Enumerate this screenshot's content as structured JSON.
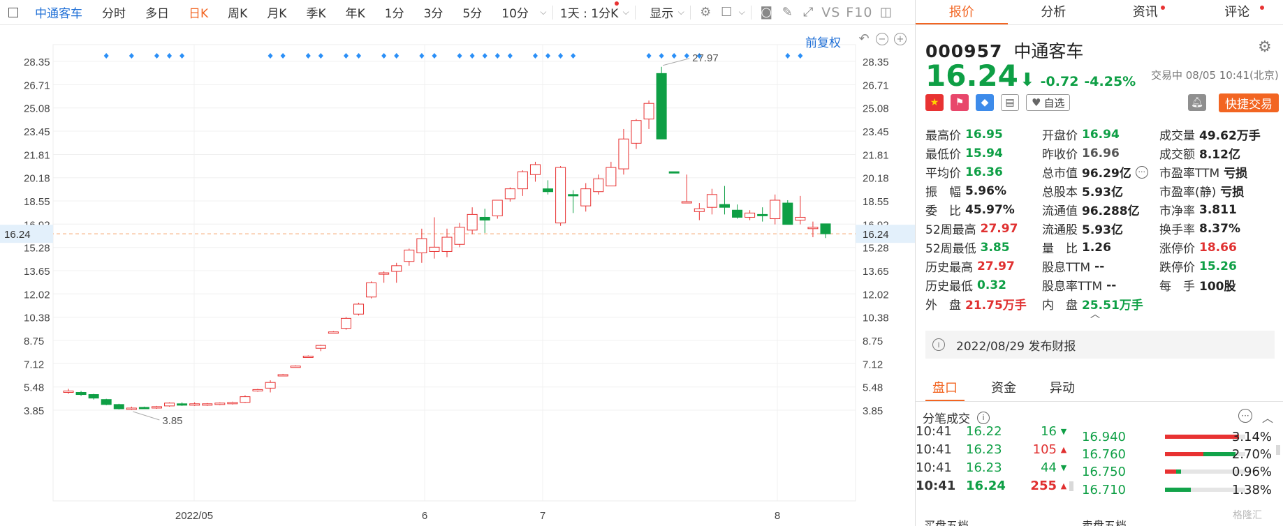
{
  "toolbar": {
    "stock_name": "中通客车",
    "periods": [
      "分时",
      "多日",
      "日K",
      "周K",
      "月K",
      "季K",
      "年K",
      "1分",
      "3分",
      "5分",
      "10分"
    ],
    "active_period": "日K",
    "range_select": "1天 : 1分K",
    "display_label": "显示",
    "vs_label": "VS",
    "f10_label": "F10"
  },
  "chart": {
    "fq_label": "前复权",
    "ctrl_labels": [
      "−",
      "+"
    ]
  },
  "chart_data": {
    "type": "candlestick",
    "y_ticks": [
      28.35,
      26.71,
      25.08,
      23.45,
      21.81,
      20.18,
      18.55,
      16.92,
      15.28,
      13.65,
      12.02,
      10.38,
      8.75,
      7.12,
      5.48,
      3.85
    ],
    "x_labels": [
      "2022/05",
      "6",
      "7",
      "8"
    ],
    "current_price": "16.24",
    "high_note": "27.97",
    "low_note": "3.85",
    "candles": [
      [
        5.2,
        5.35,
        5.1,
        5.0,
        "r"
      ],
      [
        5.1,
        5.2,
        4.95,
        4.85,
        "g"
      ],
      [
        4.95,
        5.0,
        4.7,
        4.6,
        "g"
      ],
      [
        4.6,
        4.65,
        4.25,
        4.2,
        "g"
      ],
      [
        4.25,
        4.3,
        3.95,
        3.9,
        "g"
      ],
      [
        3.95,
        4.1,
        4.0,
        3.85,
        "r"
      ],
      [
        4.0,
        4.1,
        4.05,
        3.95,
        "g"
      ],
      [
        4.0,
        4.15,
        4.1,
        3.95,
        "r"
      ],
      [
        4.15,
        4.4,
        4.35,
        4.1,
        "r"
      ],
      [
        4.3,
        4.4,
        4.2,
        4.15,
        "g"
      ],
      [
        4.2,
        4.4,
        4.3,
        4.15,
        "r"
      ],
      [
        4.2,
        4.35,
        4.3,
        4.15,
        "r"
      ],
      [
        4.25,
        4.4,
        4.35,
        4.2,
        "r"
      ],
      [
        4.3,
        4.45,
        4.4,
        4.25,
        "r"
      ],
      [
        4.4,
        4.9,
        4.8,
        4.35,
        "r"
      ],
      [
        5.2,
        5.35,
        5.3,
        5.15,
        "r"
      ],
      [
        5.4,
        5.95,
        5.8,
        5.1,
        "r"
      ],
      [
        6.3,
        6.4,
        6.35,
        6.25,
        "r"
      ],
      [
        6.9,
        7.0,
        6.95,
        6.85,
        "r"
      ],
      [
        7.6,
        7.7,
        7.65,
        7.55,
        "r"
      ],
      [
        8.2,
        8.45,
        8.4,
        8.0,
        "r"
      ],
      [
        9.3,
        9.4,
        9.35,
        9.25,
        "r"
      ],
      [
        9.6,
        10.4,
        10.3,
        9.5,
        "r"
      ],
      [
        10.6,
        11.4,
        11.3,
        10.5,
        "r"
      ],
      [
        11.8,
        12.9,
        12.8,
        11.7,
        "r"
      ],
      [
        13.4,
        13.6,
        13.5,
        12.8,
        "r"
      ],
      [
        13.6,
        14.2,
        14.0,
        12.8,
        "r"
      ],
      [
        14.3,
        15.2,
        15.1,
        14.0,
        "r"
      ],
      [
        14.9,
        16.6,
        15.9,
        14.2,
        "r"
      ],
      [
        15.0,
        17.4,
        15.3,
        14.5,
        "r"
      ],
      [
        15.0,
        16.6,
        16.0,
        14.6,
        "r"
      ],
      [
        15.5,
        17.0,
        16.7,
        15.3,
        "r"
      ],
      [
        16.5,
        18.1,
        17.6,
        16.2,
        "r"
      ],
      [
        17.4,
        18.0,
        17.2,
        16.3,
        "g"
      ],
      [
        17.5,
        18.6,
        18.6,
        17.3,
        "r"
      ],
      [
        18.7,
        19.5,
        19.4,
        18.5,
        "r"
      ],
      [
        19.4,
        20.7,
        20.6,
        18.9,
        "r"
      ],
      [
        20.4,
        21.3,
        21.1,
        19.9,
        "r"
      ],
      [
        19.4,
        20.0,
        19.2,
        19.0,
        "g"
      ],
      [
        17.0,
        21.0,
        20.9,
        16.8,
        "r"
      ],
      [
        19.0,
        19.3,
        18.9,
        17.7,
        "g"
      ],
      [
        18.2,
        19.8,
        19.4,
        17.8,
        "r"
      ],
      [
        19.2,
        20.4,
        20.1,
        19.0,
        "r"
      ],
      [
        19.6,
        21.3,
        20.9,
        19.6,
        "r"
      ],
      [
        20.8,
        23.6,
        22.9,
        20.4,
        "r"
      ],
      [
        22.6,
        24.3,
        24.2,
        22.2,
        "r"
      ],
      [
        24.3,
        25.6,
        25.4,
        23.6,
        "r"
      ],
      [
        27.5,
        27.97,
        22.9,
        22.9,
        "g"
      ],
      [
        20.6,
        20.6,
        20.6,
        20.5,
        "g"
      ],
      [
        18.5,
        20.4,
        18.5,
        18.4,
        "r"
      ],
      [
        17.8,
        18.4,
        18.0,
        17.2,
        "r"
      ],
      [
        18.1,
        19.4,
        19.0,
        17.6,
        "r"
      ],
      [
        18.3,
        19.6,
        18.1,
        17.6,
        "g"
      ],
      [
        17.9,
        18.3,
        17.4,
        17.3,
        "g"
      ],
      [
        17.4,
        17.9,
        17.7,
        17.2,
        "r"
      ],
      [
        17.6,
        18.1,
        17.55,
        17.1,
        "g"
      ],
      [
        17.3,
        19.0,
        18.6,
        16.9,
        "r"
      ],
      [
        18.4,
        18.6,
        16.9,
        16.9,
        "g"
      ],
      [
        17.2,
        18.9,
        17.4,
        16.9,
        "r"
      ],
      [
        16.6,
        17.1,
        16.7,
        16.0,
        "r"
      ],
      [
        16.94,
        16.95,
        16.24,
        15.94,
        "g"
      ]
    ],
    "blue_marker_indices": [
      3,
      5,
      7,
      8,
      9,
      16,
      17,
      19,
      20,
      22,
      23,
      25,
      26,
      28,
      29,
      31,
      32,
      33,
      34,
      35,
      37,
      38,
      39,
      40,
      46,
      47,
      48,
      49,
      50,
      57,
      58
    ]
  },
  "panel": {
    "tabs": [
      "报价",
      "分析",
      "资讯",
      "评论"
    ],
    "active_tab": "报价",
    "code": "000957",
    "name": "中通客车",
    "price": "16.24",
    "arrow": "⬇",
    "change": "-0.72",
    "change_pct": "-4.25%",
    "status": "交易中 08/05 10:41(北京)",
    "watch_label": "自选",
    "quick_trade": "快捷交易",
    "stats": [
      [
        {
          "l": "最高价",
          "v": "16.95",
          "c": "c-green"
        },
        {
          "l": "开盘价",
          "v": "16.94",
          "c": "c-green"
        },
        {
          "l": "成交量",
          "v": "49.62万手",
          "c": "c-dark"
        }
      ],
      [
        {
          "l": "最低价",
          "v": "15.94",
          "c": "c-green"
        },
        {
          "l": "昨收价",
          "v": "16.96",
          "c": "c-gray"
        },
        {
          "l": "成交额",
          "v": "8.12亿",
          "c": "c-dark"
        }
      ],
      [
        {
          "l": "平均价",
          "v": "16.36",
          "c": "c-green"
        },
        {
          "l": "总市值",
          "v": "96.29亿",
          "c": "c-dark"
        },
        {
          "l": "市盈率TTM",
          "v": "亏损",
          "c": "c-dark"
        }
      ],
      [
        {
          "l": "振　幅",
          "v": "5.96%",
          "c": "c-dark"
        },
        {
          "l": "总股本",
          "v": "5.93亿",
          "c": "c-dark"
        },
        {
          "l": "市盈率(静)",
          "v": "亏损",
          "c": "c-dark"
        }
      ],
      [
        {
          "l": "委　比",
          "v": "45.97%",
          "c": "c-dark"
        },
        {
          "l": "流通值",
          "v": "96.288亿",
          "c": "c-dark"
        },
        {
          "l": "市净率",
          "v": "3.811",
          "c": "c-dark"
        }
      ],
      [
        {
          "l": "52周最高",
          "v": "27.97",
          "c": "c-red"
        },
        {
          "l": "流通股",
          "v": "5.93亿",
          "c": "c-dark"
        },
        {
          "l": "换手率",
          "v": "8.37%",
          "c": "c-dark"
        }
      ],
      [
        {
          "l": "52周最低",
          "v": "3.85",
          "c": "c-green"
        },
        {
          "l": "量　比",
          "v": "1.26",
          "c": "c-dark"
        },
        {
          "l": "涨停价",
          "v": "18.66",
          "c": "c-red"
        }
      ],
      [
        {
          "l": "历史最高",
          "v": "27.97",
          "c": "c-red"
        },
        {
          "l": "股息TTM",
          "v": "--",
          "c": "c-dark"
        },
        {
          "l": "跌停价",
          "v": "15.26",
          "c": "c-green"
        }
      ],
      [
        {
          "l": "历史最低",
          "v": "0.32",
          "c": "c-green"
        },
        {
          "l": "股息率TTM",
          "v": "--",
          "c": "c-dark"
        },
        {
          "l": "每　手",
          "v": "100股",
          "c": "c-dark"
        }
      ],
      [
        {
          "l": "外　盘",
          "v": "21.75万手",
          "c": "c-red"
        },
        {
          "l": "内　盘",
          "v": "25.51万手",
          "c": "c-green"
        },
        {
          "l": "",
          "v": "",
          "c": "c-dark"
        }
      ]
    ],
    "report_text": "2022/08/29 发布财报",
    "sub_tabs": [
      "盘口",
      "资金",
      "异动"
    ],
    "active_sub_tab": "盘口",
    "ticks_title": "分笔成交",
    "ticks": [
      {
        "t": "10:41",
        "p": "16.22",
        "v": "16",
        "d": "down",
        "bold": false
      },
      {
        "t": "10:41",
        "p": "16.23",
        "v": "105",
        "d": "up",
        "bold": false
      },
      {
        "t": "10:41",
        "p": "16.23",
        "v": "44",
        "d": "down",
        "bold": false
      },
      {
        "t": "10:41",
        "p": "16.24",
        "v": "255",
        "d": "up",
        "bold": true
      }
    ],
    "dist": [
      {
        "p": "16.940",
        "r": 0.92,
        "g": 0.0,
        "pct": "3.14%"
      },
      {
        "p": "16.760",
        "r": 0.48,
        "g": 0.4,
        "pct": "2.70%"
      },
      {
        "p": "16.750",
        "r": 0.14,
        "g": 0.06,
        "pct": "0.96%"
      },
      {
        "p": "16.710",
        "r": 0.0,
        "g": 0.32,
        "pct": "1.38%"
      }
    ],
    "buy5": "买盘五档",
    "sell5": "卖盘五档",
    "watermark": "格隆汇"
  }
}
